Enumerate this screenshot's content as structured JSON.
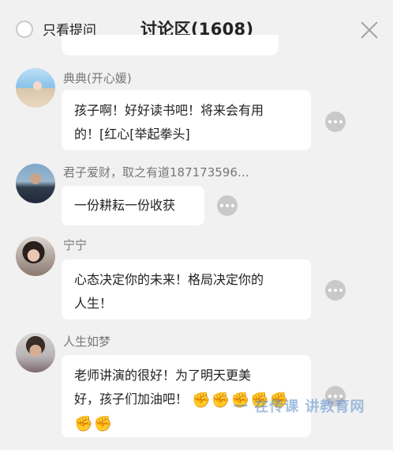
{
  "header": {
    "only_questions_label": "只看提问",
    "title": "讨论区(1608)"
  },
  "comments": [
    {
      "username": "典典(开心媛)",
      "text_line1": "孩子啊！好好读书吧！将来会有用",
      "text_line2": "的！[红心[举起拳头]"
    },
    {
      "username": "君子爱财，取之有道187173596…",
      "text_line1": "一份耕耘一份收获"
    },
    {
      "username": "宁宁",
      "text_line1": "心态决定你的未来！格局决定你的",
      "text_line2": "人生！"
    },
    {
      "username": "人生如梦",
      "text_line1": "老师讲演的很好！为了明天更美",
      "text_line2": "好，孩子们加油吧！"
    }
  ],
  "icons": {
    "close": "close-icon",
    "more": "more-icon",
    "fist": "fist-emoji"
  },
  "watermark": "一 在传课 讲教育网",
  "colors": {
    "background": "#f1f1f1",
    "bubble": "#ffffff",
    "username": "#777777",
    "text": "#222222"
  }
}
